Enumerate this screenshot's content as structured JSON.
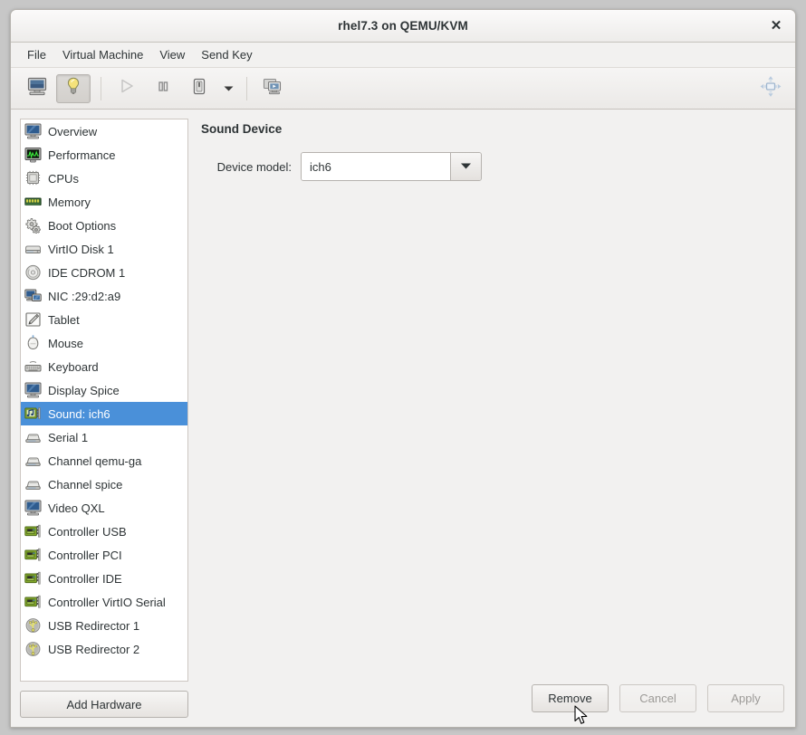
{
  "window": {
    "title": "rhel7.3 on QEMU/KVM",
    "close_label": "✕"
  },
  "menubar": {
    "items": [
      {
        "label": "File",
        "name": "menu-file"
      },
      {
        "label": "Virtual Machine",
        "name": "menu-virtual-machine"
      },
      {
        "label": "View",
        "name": "menu-view"
      },
      {
        "label": "Send Key",
        "name": "menu-send-key"
      }
    ]
  },
  "toolbar": {
    "buttons": [
      {
        "icon": "console-monitor-icon",
        "name": "show-console-button",
        "state": "normal"
      },
      {
        "icon": "lightbulb-details-icon",
        "name": "show-details-button",
        "state": "active"
      },
      {
        "icon": "play-icon",
        "name": "run-button",
        "state": "disabled"
      },
      {
        "icon": "pause-icon",
        "name": "pause-button",
        "state": "normal"
      },
      {
        "icon": "shutdown-icon",
        "name": "shutdown-button",
        "state": "normal"
      },
      {
        "icon": "chevron-down-icon",
        "name": "shutdown-dropdown-button",
        "state": "normal"
      },
      {
        "icon": "snapshot-screens-icon",
        "name": "snapshots-button",
        "state": "normal"
      }
    ],
    "right_icon": "fullscreen-resize-icon",
    "right_name": "fullscreen-button"
  },
  "sidebar": {
    "items": [
      {
        "label": "Overview",
        "icon": "monitor-icon",
        "selected": false
      },
      {
        "label": "Performance",
        "icon": "performance-graph-icon",
        "selected": false
      },
      {
        "label": "CPUs",
        "icon": "cpu-chip-icon",
        "selected": false
      },
      {
        "label": "Memory",
        "icon": "memory-ram-icon",
        "selected": false
      },
      {
        "label": "Boot Options",
        "icon": "gears-icon",
        "selected": false
      },
      {
        "label": "VirtIO Disk 1",
        "icon": "harddisk-icon",
        "selected": false
      },
      {
        "label": "IDE CDROM 1",
        "icon": "cdrom-disc-icon",
        "selected": false
      },
      {
        "label": "NIC :29:d2:a9",
        "icon": "network-card-icon",
        "selected": false
      },
      {
        "label": "Tablet",
        "icon": "tablet-pen-icon",
        "selected": false
      },
      {
        "label": "Mouse",
        "icon": "mouse-icon",
        "selected": false
      },
      {
        "label": "Keyboard",
        "icon": "keyboard-icon",
        "selected": false
      },
      {
        "label": "Display Spice",
        "icon": "display-monitor-icon",
        "selected": false
      },
      {
        "label": "Sound: ich6",
        "icon": "sound-card-icon",
        "selected": true
      },
      {
        "label": "Serial 1",
        "icon": "serial-port-icon",
        "selected": false
      },
      {
        "label": "Channel qemu-ga",
        "icon": "serial-port-icon",
        "selected": false
      },
      {
        "label": "Channel spice",
        "icon": "serial-port-icon",
        "selected": false
      },
      {
        "label": "Video QXL",
        "icon": "display-monitor-icon",
        "selected": false
      },
      {
        "label": "Controller USB",
        "icon": "controller-card-icon",
        "selected": false
      },
      {
        "label": "Controller PCI",
        "icon": "controller-card-icon",
        "selected": false
      },
      {
        "label": "Controller IDE",
        "icon": "controller-card-icon",
        "selected": false
      },
      {
        "label": "Controller VirtIO Serial",
        "icon": "controller-card-icon",
        "selected": false
      },
      {
        "label": "USB Redirector 1",
        "icon": "usb-icon",
        "selected": false
      },
      {
        "label": "USB Redirector 2",
        "icon": "usb-icon",
        "selected": false
      }
    ],
    "add_hardware_label": "Add Hardware"
  },
  "main": {
    "section_title": "Sound Device",
    "device_model_label": "Device model:",
    "device_model_value": "ich6",
    "device_model_options": [
      "ich6"
    ]
  },
  "footer": {
    "remove_label": "Remove",
    "cancel_label": "Cancel",
    "apply_label": "Apply"
  },
  "colors": {
    "selection_blue": "#4a90d9",
    "window_bg": "#f2f1f0",
    "text": "#2e3436",
    "disabled_text": "#9c9a97"
  }
}
